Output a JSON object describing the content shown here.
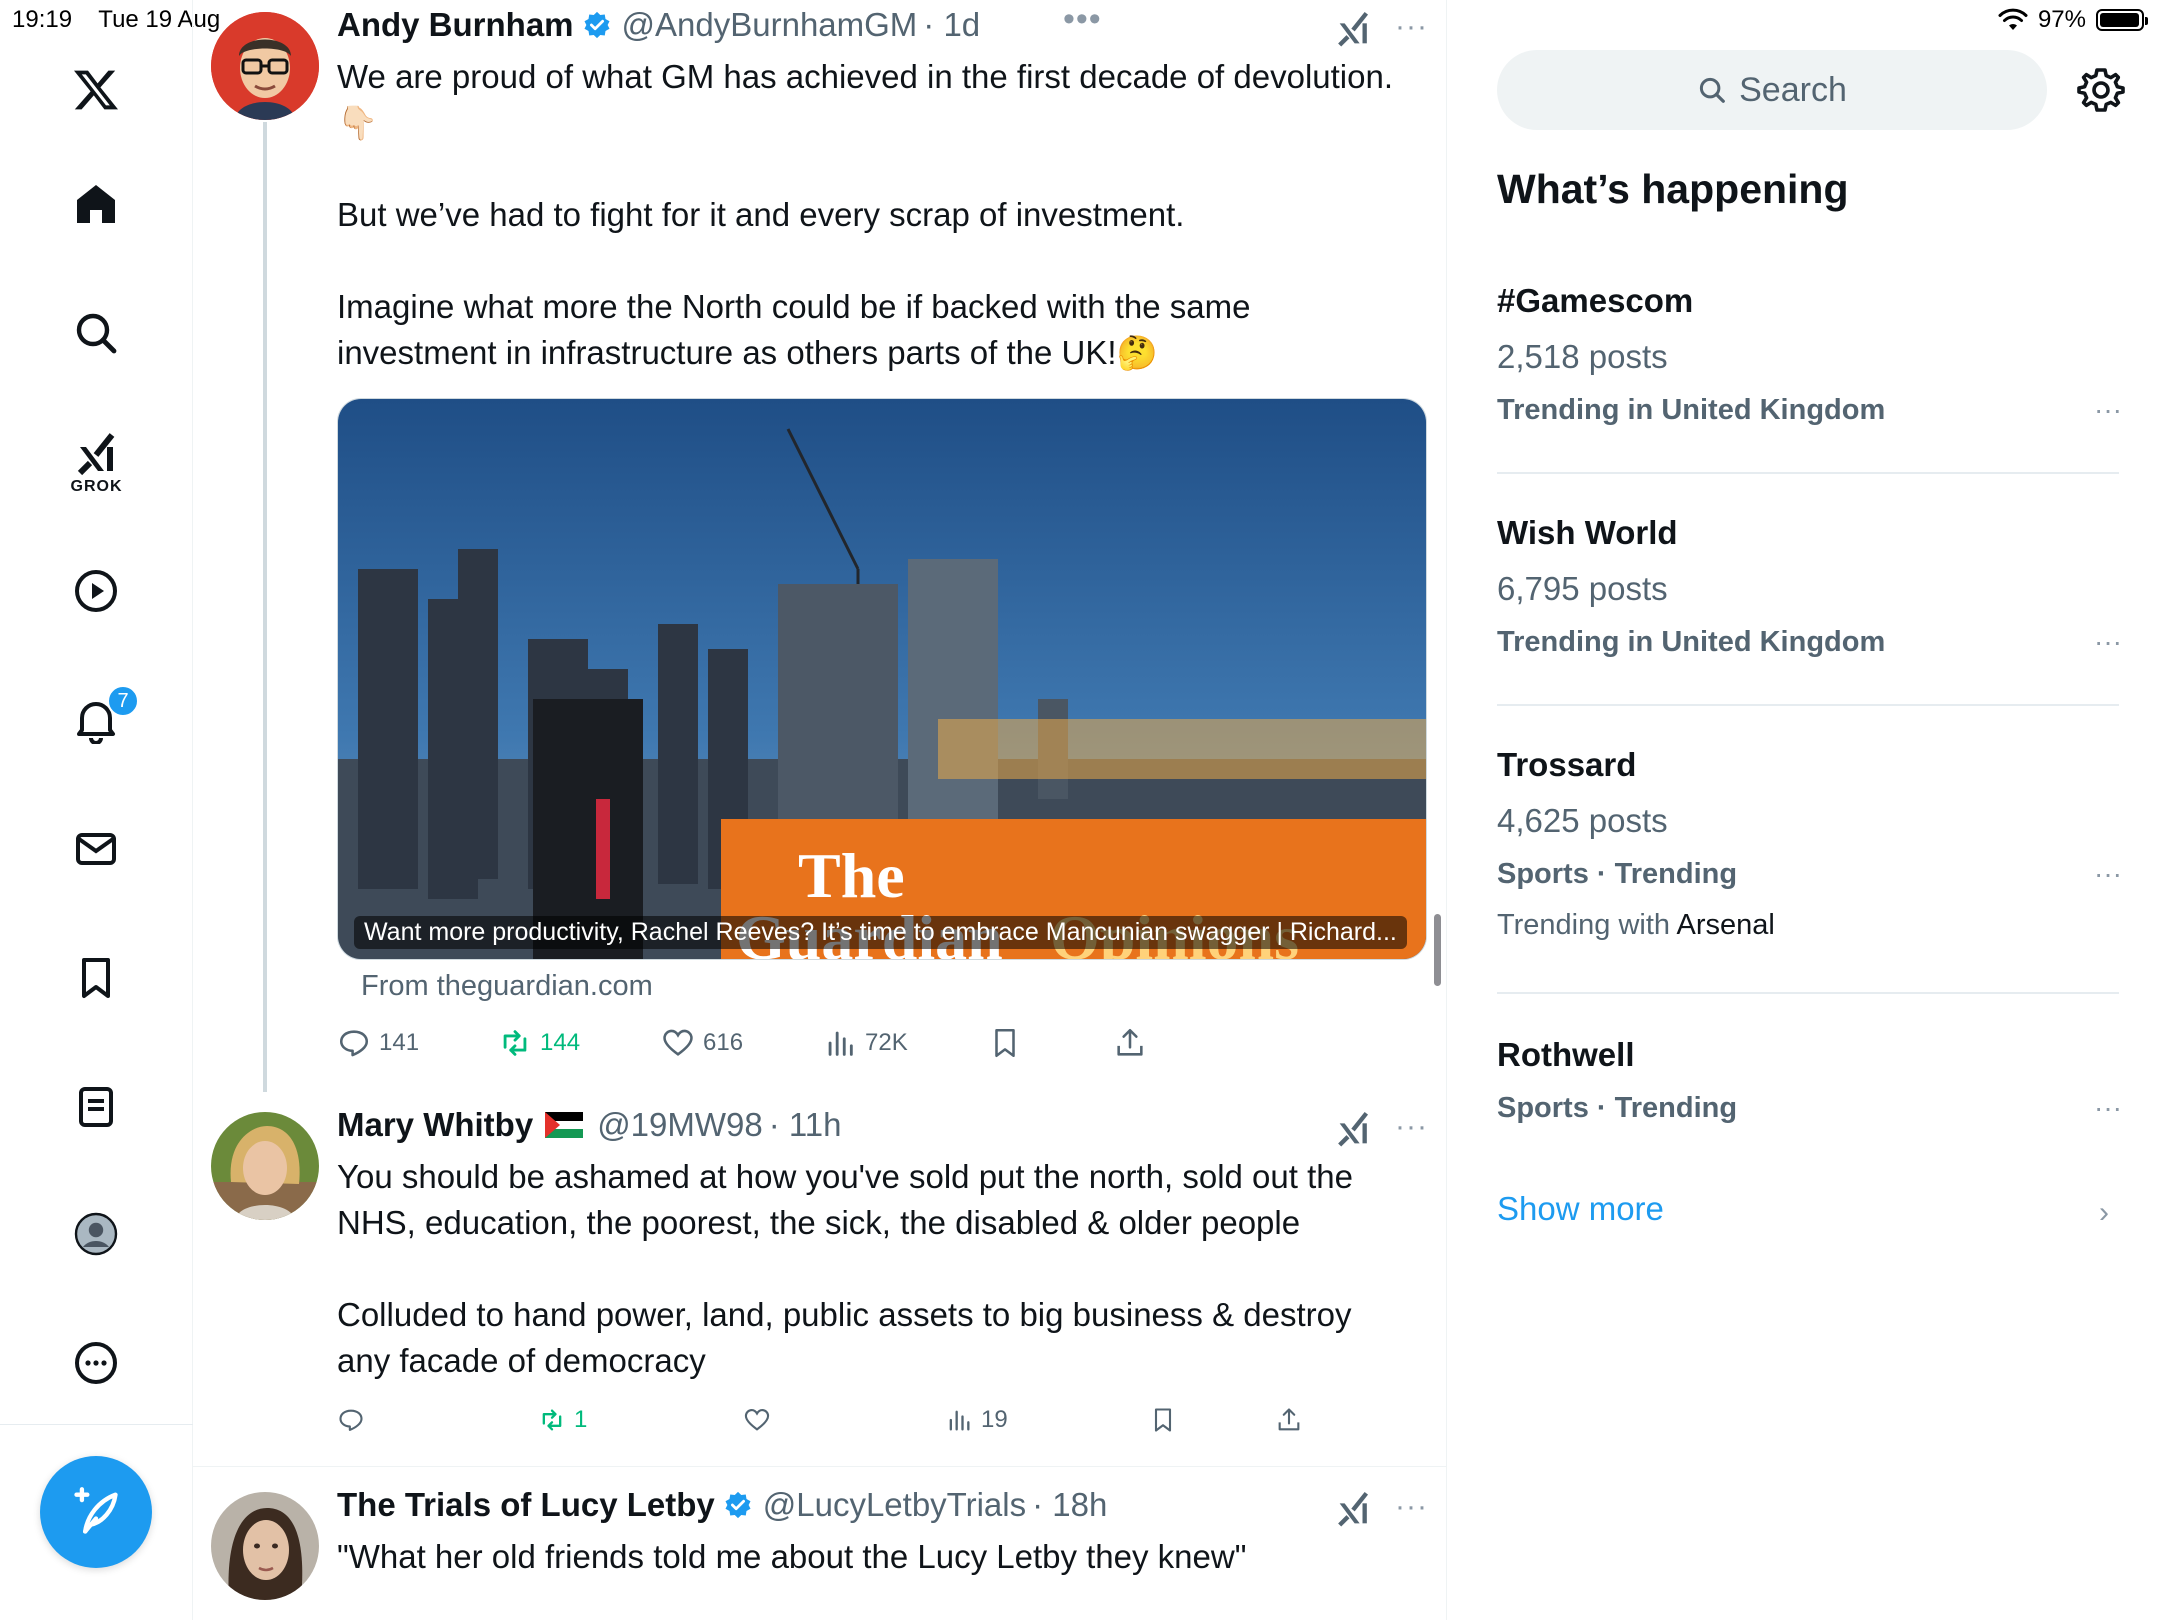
{
  "status_bar": {
    "time": "19:19",
    "date": "Tue 19 Aug",
    "battery": "97%",
    "battery_level": 0.97
  },
  "nav": {
    "grok_label": "GROK",
    "notifications_badge": "7",
    "icons": [
      "x-logo-icon",
      "home-icon",
      "search-icon",
      "grok-icon",
      "video-icon",
      "notifications-icon",
      "messages-icon",
      "bookmarks-icon",
      "lists-icon",
      "profile-icon",
      "more-icon",
      "compose-icon"
    ]
  },
  "timeline": {
    "tweets": [
      {
        "name": "Andy Burnham",
        "verified": true,
        "handle": "@AndyBurnhamGM",
        "time": "· 1d",
        "body": "We are proud of what GM has achieved in the first decade of devolution. 👇🏻\n\nBut we’ve had to fight for it and every scrap of investment.\n\nImagine what more the North could be if backed with the same investment in infrastructure as others parts of the UK!🤔",
        "card": {
          "brand_line1": "The",
          "brand_line2_a": "Guardian",
          "brand_line2_b": "Opinions",
          "caption": "Want more productivity, Rachel Reeves? It’s time to embrace Mancunian swagger | Richard...",
          "source": "From theguardian.com"
        },
        "stats": {
          "replies": "141",
          "reposts": "144",
          "likes": "616",
          "views": "72K"
        }
      },
      {
        "name": "Mary Whitby",
        "flag": "🇵🇸",
        "handle": "@19MW98",
        "time": "· 11h",
        "body": "You should be ashamed at how you've sold put the north, sold out the NHS, education, the poorest, the sick, the disabled & older people\n\nColluded to hand power, land, public assets to big business & destroy any facade of democracy",
        "stats": {
          "replies": "",
          "reposts": "1",
          "likes": "",
          "views": "19"
        }
      },
      {
        "name": "The Trials of Lucy Letby",
        "verified": true,
        "handle": "@LucyLetbyTrials",
        "time": "· 18h",
        "body": "\"What her old friends told me about the Lucy Letby they knew\""
      }
    ]
  },
  "sidebar": {
    "search_placeholder": "Search",
    "title": "What’s happening",
    "trends": [
      {
        "name": "#Gamescom",
        "posts": "2,518 posts",
        "context": "Trending in United Kingdom"
      },
      {
        "name": "Wish World",
        "posts": "6,795 posts",
        "context": "Trending in United Kingdom"
      },
      {
        "name": "Trossard",
        "posts": "4,625 posts",
        "context": "Sports · Trending",
        "with_prefix": "Trending with",
        "with_topic": "Arsenal"
      },
      {
        "name": "Rothwell",
        "context": "Sports · Trending"
      }
    ],
    "show_more": "Show more"
  },
  "colors": {
    "accent": "#1d9bf0",
    "repost": "#00ba7c",
    "secondary_text": "#536471",
    "guardian_orange": "#e8731c"
  }
}
